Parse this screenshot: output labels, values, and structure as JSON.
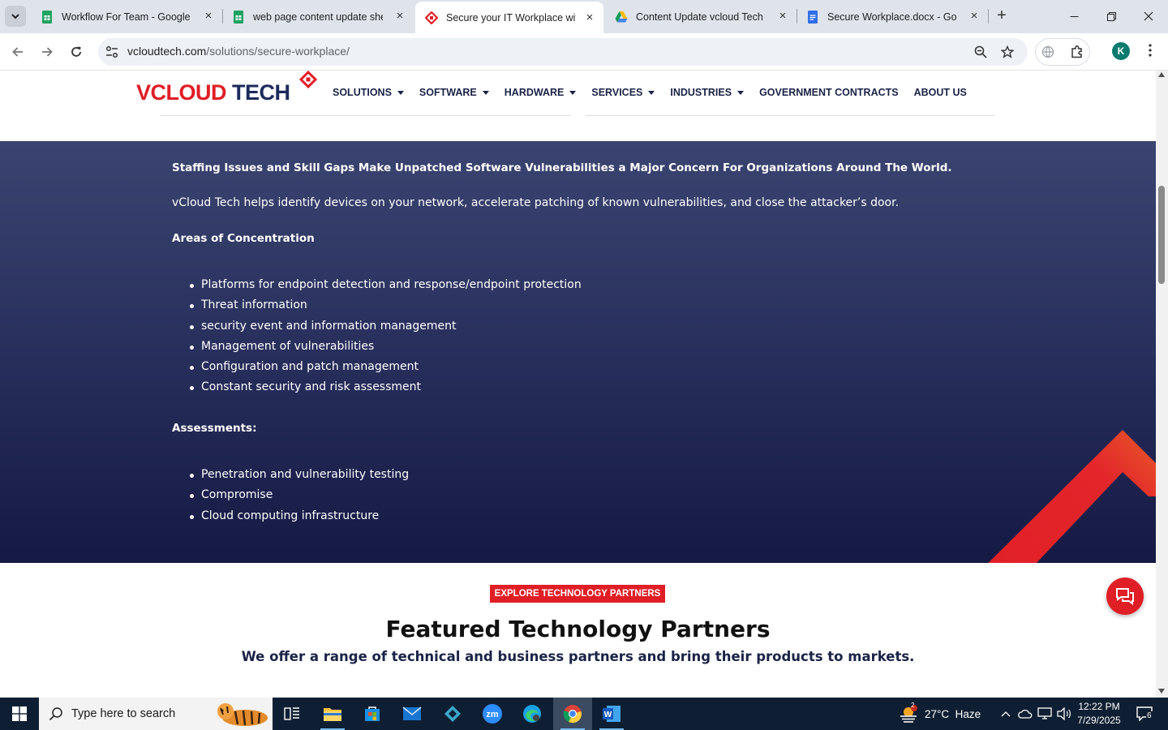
{
  "browser": {
    "tabs": [
      {
        "title": "Workflow For Team - Google Sheets",
        "icon": "google-sheets-icon",
        "active": false
      },
      {
        "title": "web page content update sheet",
        "icon": "google-sheets-icon",
        "active": false
      },
      {
        "title": "Secure your IT Workplace with",
        "icon": "vcloud-tech-icon",
        "active": true
      },
      {
        "title": "Content Update vcloud Tech - Google Drive",
        "icon": "google-drive-icon",
        "active": false
      },
      {
        "title": "Secure Workplace.docx - Google Docs",
        "icon": "google-docs-icon",
        "active": false
      }
    ],
    "url_host": "vcloudtech.com",
    "url_path": "/solutions/secure-workplace/",
    "profile_initial": "K"
  },
  "site": {
    "logo_parts": {
      "v": "V",
      "cloud": "CLOUD",
      "tech": " TECH"
    },
    "nav": [
      {
        "label": "SOLUTIONS",
        "dropdown": true
      },
      {
        "label": "SOFTWARE",
        "dropdown": true
      },
      {
        "label": "HARDWARE",
        "dropdown": true
      },
      {
        "label": "SERVICES",
        "dropdown": true
      },
      {
        "label": "INDUSTRIES",
        "dropdown": true
      },
      {
        "label": "GOVERNMENT CONTRACTS",
        "dropdown": false
      },
      {
        "label": "ABOUT US",
        "dropdown": false
      }
    ]
  },
  "hero": {
    "headline": "Staffing Issues and Skill Gaps Make Unpatched Software Vulnerabilities a Major Concern For Organizations Around The World.",
    "intro": "vCloud Tech helps identify devices on your network, accelerate patching of known vulnerabilities, and close the attacker’s door.",
    "areas_heading": "Areas of Concentration",
    "areas": [
      "Platforms for endpoint detection and response/endpoint protection",
      "Threat information",
      "security event and information management",
      "Management of vulnerabilities",
      "Configuration and patch management",
      "Constant security and risk assessment"
    ],
    "assessments_heading": "Assessments:",
    "assessments": [
      "Penetration and vulnerability testing",
      "Compromise",
      "Cloud computing infrastructure"
    ]
  },
  "partners": {
    "button": "EXPLORE TECHNOLOGY PARTNERS",
    "title": "Featured Technology Partners",
    "subtitle": "We offer a range of technical and business partners and bring their products to markets."
  },
  "taskbar": {
    "search_placeholder": "Type here to search",
    "weather_badge": "2",
    "weather": "27°C  Haze",
    "time": "12:22 PM",
    "date": "7/29/2025",
    "notifications": "6"
  },
  "colors": {
    "brand_red": "#e01e26",
    "brand_navy": "#1d2a5c",
    "hero_top": "#3b4470",
    "hero_bottom": "#151a44"
  }
}
